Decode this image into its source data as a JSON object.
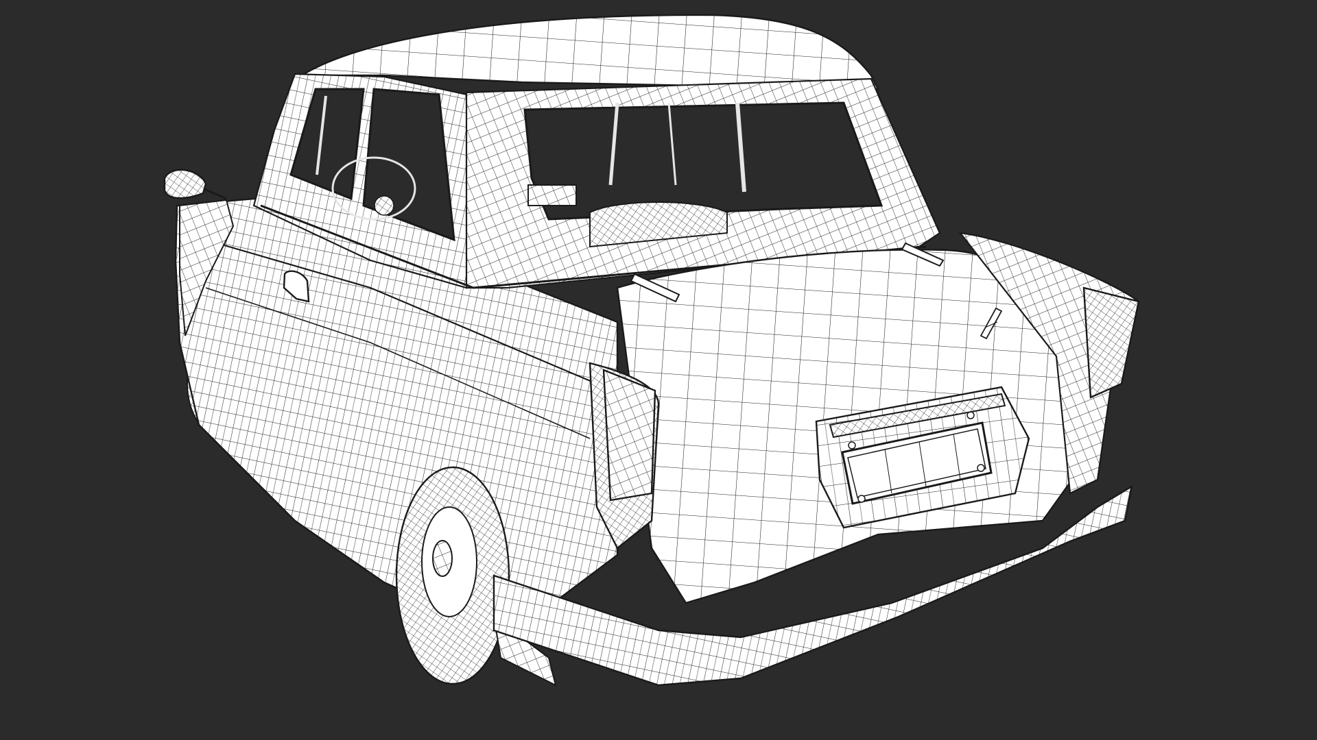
{
  "scene": {
    "background_color": "#2b2b2b",
    "model_fill": "#ffffff",
    "wire_color": "#1a1a1a",
    "window_color": "#2b2b2b",
    "render_mode": "wireframe-on-shaded",
    "subject": "car-rear-three-quarter"
  }
}
